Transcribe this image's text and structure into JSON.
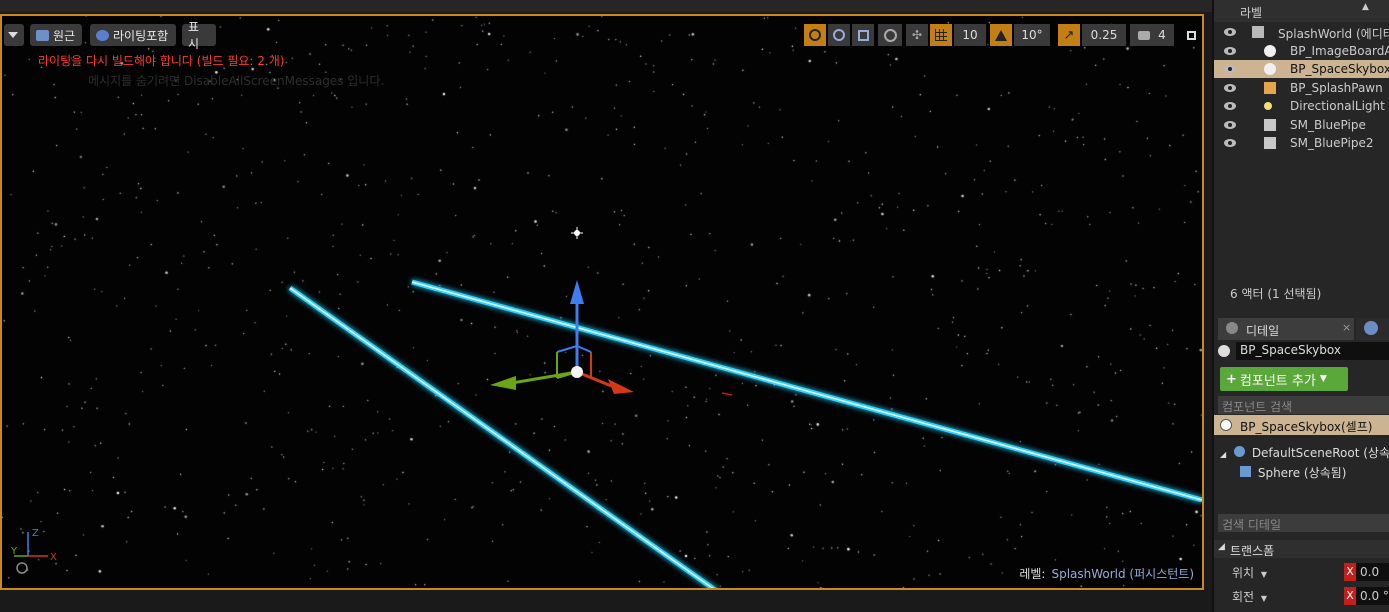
{
  "viewport": {
    "perspective_label": "원근",
    "lighting_label": "라이팅포함",
    "show_label": "표시",
    "grid_snap_value": "10",
    "rotation_snap_value": "10°",
    "scale_snap_value": "0.25",
    "camera_speed_value": "4",
    "warning_text": "라이팅을 다시 빌드해야 합니다 (빌드 필요: 2 개)",
    "hint_text": "메시지를 숨기려면 DisableAllScreenMessages 입니다.",
    "level_label": "레벨:",
    "level_value": "SplashWorld (퍼시스턴트)",
    "axis_labels": {
      "z": "Z",
      "x": "X",
      "y": "Y"
    }
  },
  "outliner": {
    "header_label": "라벨",
    "items": [
      {
        "label": "SplashWorld (에디터)",
        "icon": "world-icon",
        "selected": false
      },
      {
        "label": "BP_ImageBoardActor",
        "icon": "blueprint-sphere-icon",
        "selected": false
      },
      {
        "label": "BP_SpaceSkybox",
        "icon": "blueprint-sphere-icon",
        "selected": true
      },
      {
        "label": "BP_SplashPawn",
        "icon": "pawn-icon",
        "selected": false
      },
      {
        "label": "DirectionalLight",
        "icon": "directional-light-icon",
        "selected": false
      },
      {
        "label": "SM_BluePipe",
        "icon": "static-mesh-icon",
        "selected": false
      },
      {
        "label": "SM_BluePipe2",
        "icon": "static-mesh-icon",
        "selected": false
      }
    ],
    "footer_text": "6 액터 (1 선택됨)"
  },
  "details": {
    "tab_label": "디테일",
    "actor_name": "BP_SpaceSkybox",
    "add_component_label": "컴포넌트 추가",
    "component_search_placeholder": "컴포넌트 검색",
    "self_component": "BP_SpaceSkybox(셀프)",
    "tree": [
      {
        "label": "DefaultSceneRoot (상속됨)"
      },
      {
        "label": "Sphere (상속됨)"
      }
    ],
    "detail_search_placeholder": "검색 디테일",
    "transform_section": "트랜스폼",
    "location_label": "위치",
    "rotation_label": "회전",
    "location_x": "0.0",
    "rotation_x": "0.0 °"
  }
}
